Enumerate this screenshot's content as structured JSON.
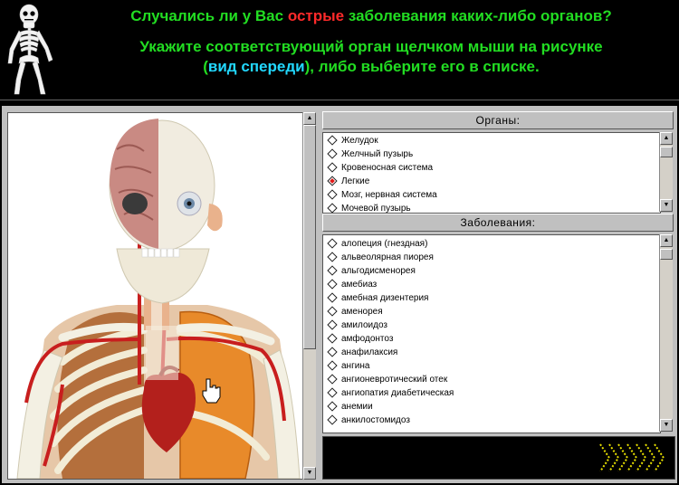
{
  "header": {
    "question_part1": "Случались ли у Вас ",
    "question_acute": "острые",
    "question_part2": " заболевания каких-либо органов?",
    "instruction_line1": "Укажите соответствующий орган щелчком мыши на рисунке",
    "instruction_view": "вид спереди",
    "instruction_open": "(",
    "instruction_close": ")",
    "instruction_rest": ", либо выберите его в списке."
  },
  "organs_panel": {
    "title": "Органы:",
    "items": [
      {
        "label": "Желудок",
        "selected": false
      },
      {
        "label": "Желчный пузырь",
        "selected": false
      },
      {
        "label": "Кровеносная система",
        "selected": false
      },
      {
        "label": "Легкие",
        "selected": true
      },
      {
        "label": "Мозг, нервная система",
        "selected": false
      },
      {
        "label": "Мочевой пузырь",
        "selected": false
      }
    ]
  },
  "diseases_panel": {
    "title": "Заболевания:",
    "items": [
      "алопеция (гнездная)",
      "альвеолярная пиорея",
      "альгодисменорея",
      "амебиаз",
      "амебная дизентерия",
      "аменорея",
      "амилоидоз",
      "амфодонтоз",
      "анафилаксия",
      "ангина",
      "ангионевротический отек",
      "ангиопатия диабетическая",
      "анемии",
      "анкилостомидоз"
    ]
  },
  "colors": {
    "accent_green": "#22dd22",
    "accent_red": "#ff2a2a",
    "accent_cyan": "#22d8ff",
    "next_yellow": "#e8e000"
  },
  "icons": {
    "skeleton": "skeleton-logo",
    "next": "next-arrows-icon",
    "cursor": "hand-pointer-icon"
  }
}
